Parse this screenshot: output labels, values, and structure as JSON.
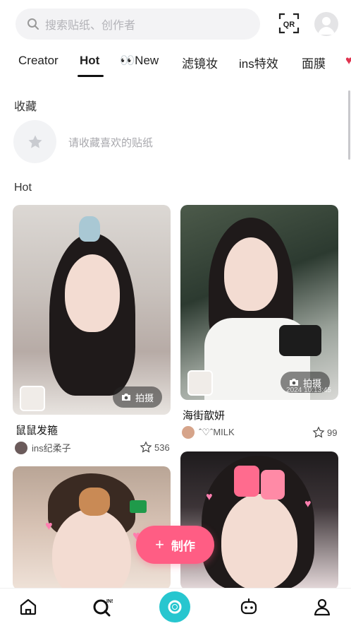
{
  "search": {
    "placeholder": "搜索贴纸、创作者"
  },
  "header": {
    "qr_label": "QR"
  },
  "tabs": [
    {
      "label": "Creator"
    },
    {
      "label": "Hot"
    },
    {
      "label": "👀New"
    },
    {
      "label": "滤镜妆"
    },
    {
      "label": "ins特效"
    },
    {
      "label": "面膜"
    }
  ],
  "favorites": {
    "heading": "收藏",
    "empty_hint": "请收藏喜欢的贴纸"
  },
  "hot": {
    "heading": "Hot"
  },
  "cards": [
    {
      "title": "鼠鼠发箍",
      "author": "ins纪柔子",
      "likes": "536",
      "shoot_label": "拍摄"
    },
    {
      "title": "海街歆妍",
      "author": "ˆ♡ˆMILK",
      "likes": "99",
      "shoot_label": "拍摄",
      "timestamp": "2024 10:13:45"
    },
    {
      "title": "",
      "author": "",
      "likes": ""
    },
    {
      "title": "",
      "author": "",
      "likes": ""
    }
  ],
  "make_button": {
    "label": "制作"
  },
  "colors": {
    "accent": "#ff5d84",
    "camera": "#27c6cf"
  },
  "bottom_nav": [
    {
      "icon": "home-icon"
    },
    {
      "icon": "ins-search-icon"
    },
    {
      "icon": "camera-icon"
    },
    {
      "icon": "robot-icon"
    },
    {
      "icon": "profile-icon"
    }
  ]
}
